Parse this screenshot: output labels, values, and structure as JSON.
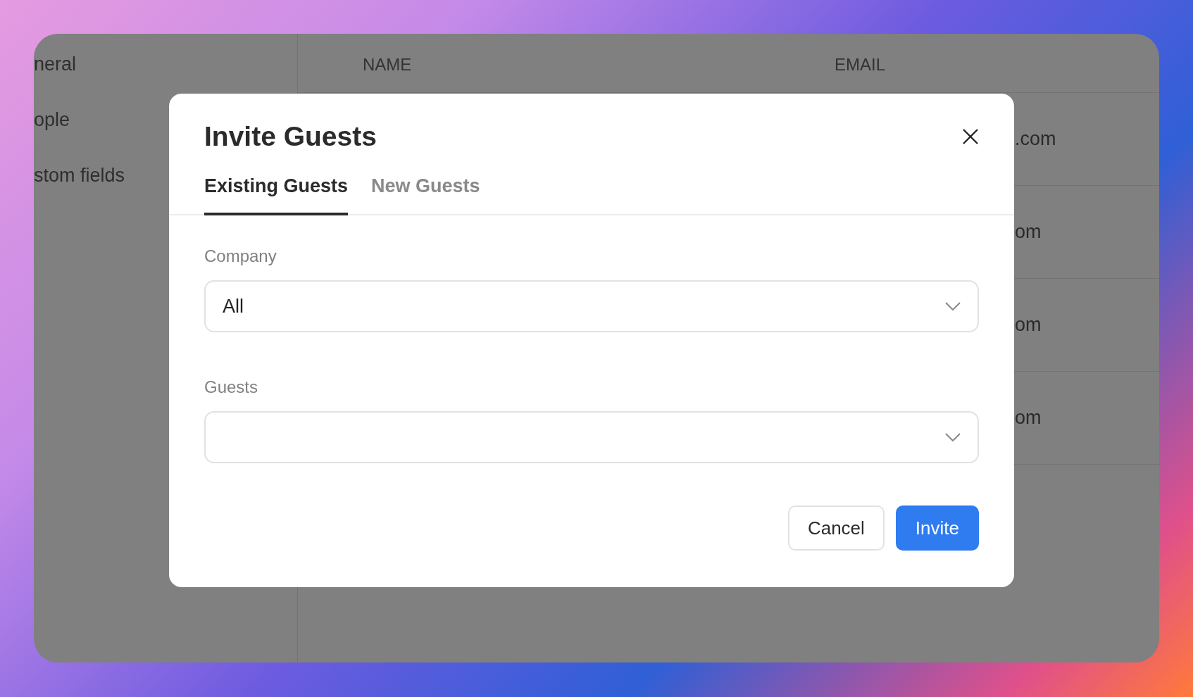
{
  "sidebar": {
    "items": [
      {
        "label": "neral"
      },
      {
        "label": "ople"
      },
      {
        "label": "stom fields"
      }
    ]
  },
  "table": {
    "columns": [
      {
        "label": "NAME"
      },
      {
        "label": "EMAIL"
      }
    ],
    "rows": [
      {
        "email": ".com"
      },
      {
        "email": "om"
      },
      {
        "email": "om"
      },
      {
        "email": "om"
      }
    ]
  },
  "modal": {
    "title": "Invite Guests",
    "tabs": [
      {
        "label": "Existing Guests",
        "selected": true
      },
      {
        "label": "New Guests",
        "selected": false
      }
    ],
    "fields": [
      {
        "label": "Company",
        "value": "All"
      },
      {
        "label": "Guests"
      }
    ],
    "buttons": [
      {
        "label": "Cancel",
        "kind": "secondary"
      },
      {
        "label": "Invite",
        "kind": "primary"
      }
    ]
  }
}
